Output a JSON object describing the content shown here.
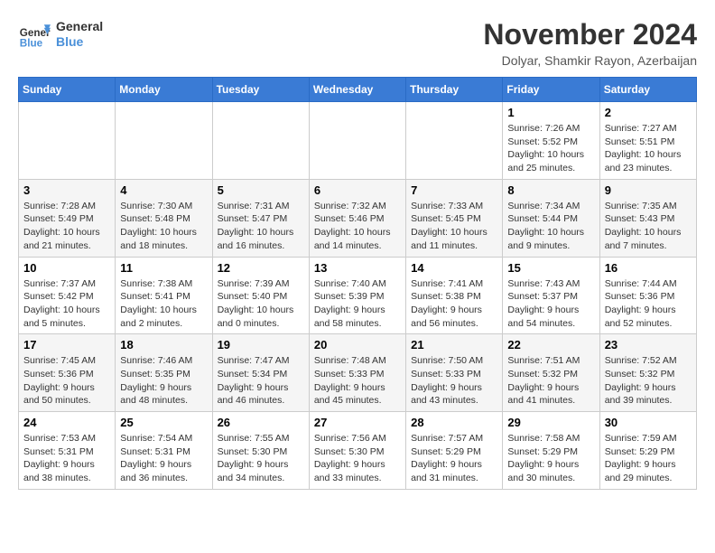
{
  "header": {
    "logo_line1": "General",
    "logo_line2": "Blue",
    "month_title": "November 2024",
    "subtitle": "Dolyar, Shamkir Rayon, Azerbaijan"
  },
  "weekdays": [
    "Sunday",
    "Monday",
    "Tuesday",
    "Wednesday",
    "Thursday",
    "Friday",
    "Saturday"
  ],
  "weeks": [
    [
      {
        "day": "",
        "info": ""
      },
      {
        "day": "",
        "info": ""
      },
      {
        "day": "",
        "info": ""
      },
      {
        "day": "",
        "info": ""
      },
      {
        "day": "",
        "info": ""
      },
      {
        "day": "1",
        "info": "Sunrise: 7:26 AM\nSunset: 5:52 PM\nDaylight: 10 hours and 25 minutes."
      },
      {
        "day": "2",
        "info": "Sunrise: 7:27 AM\nSunset: 5:51 PM\nDaylight: 10 hours and 23 minutes."
      }
    ],
    [
      {
        "day": "3",
        "info": "Sunrise: 7:28 AM\nSunset: 5:49 PM\nDaylight: 10 hours and 21 minutes."
      },
      {
        "day": "4",
        "info": "Sunrise: 7:30 AM\nSunset: 5:48 PM\nDaylight: 10 hours and 18 minutes."
      },
      {
        "day": "5",
        "info": "Sunrise: 7:31 AM\nSunset: 5:47 PM\nDaylight: 10 hours and 16 minutes."
      },
      {
        "day": "6",
        "info": "Sunrise: 7:32 AM\nSunset: 5:46 PM\nDaylight: 10 hours and 14 minutes."
      },
      {
        "day": "7",
        "info": "Sunrise: 7:33 AM\nSunset: 5:45 PM\nDaylight: 10 hours and 11 minutes."
      },
      {
        "day": "8",
        "info": "Sunrise: 7:34 AM\nSunset: 5:44 PM\nDaylight: 10 hours and 9 minutes."
      },
      {
        "day": "9",
        "info": "Sunrise: 7:35 AM\nSunset: 5:43 PM\nDaylight: 10 hours and 7 minutes."
      }
    ],
    [
      {
        "day": "10",
        "info": "Sunrise: 7:37 AM\nSunset: 5:42 PM\nDaylight: 10 hours and 5 minutes."
      },
      {
        "day": "11",
        "info": "Sunrise: 7:38 AM\nSunset: 5:41 PM\nDaylight: 10 hours and 2 minutes."
      },
      {
        "day": "12",
        "info": "Sunrise: 7:39 AM\nSunset: 5:40 PM\nDaylight: 10 hours and 0 minutes."
      },
      {
        "day": "13",
        "info": "Sunrise: 7:40 AM\nSunset: 5:39 PM\nDaylight: 9 hours and 58 minutes."
      },
      {
        "day": "14",
        "info": "Sunrise: 7:41 AM\nSunset: 5:38 PM\nDaylight: 9 hours and 56 minutes."
      },
      {
        "day": "15",
        "info": "Sunrise: 7:43 AM\nSunset: 5:37 PM\nDaylight: 9 hours and 54 minutes."
      },
      {
        "day": "16",
        "info": "Sunrise: 7:44 AM\nSunset: 5:36 PM\nDaylight: 9 hours and 52 minutes."
      }
    ],
    [
      {
        "day": "17",
        "info": "Sunrise: 7:45 AM\nSunset: 5:36 PM\nDaylight: 9 hours and 50 minutes."
      },
      {
        "day": "18",
        "info": "Sunrise: 7:46 AM\nSunset: 5:35 PM\nDaylight: 9 hours and 48 minutes."
      },
      {
        "day": "19",
        "info": "Sunrise: 7:47 AM\nSunset: 5:34 PM\nDaylight: 9 hours and 46 minutes."
      },
      {
        "day": "20",
        "info": "Sunrise: 7:48 AM\nSunset: 5:33 PM\nDaylight: 9 hours and 45 minutes."
      },
      {
        "day": "21",
        "info": "Sunrise: 7:50 AM\nSunset: 5:33 PM\nDaylight: 9 hours and 43 minutes."
      },
      {
        "day": "22",
        "info": "Sunrise: 7:51 AM\nSunset: 5:32 PM\nDaylight: 9 hours and 41 minutes."
      },
      {
        "day": "23",
        "info": "Sunrise: 7:52 AM\nSunset: 5:32 PM\nDaylight: 9 hours and 39 minutes."
      }
    ],
    [
      {
        "day": "24",
        "info": "Sunrise: 7:53 AM\nSunset: 5:31 PM\nDaylight: 9 hours and 38 minutes."
      },
      {
        "day": "25",
        "info": "Sunrise: 7:54 AM\nSunset: 5:31 PM\nDaylight: 9 hours and 36 minutes."
      },
      {
        "day": "26",
        "info": "Sunrise: 7:55 AM\nSunset: 5:30 PM\nDaylight: 9 hours and 34 minutes."
      },
      {
        "day": "27",
        "info": "Sunrise: 7:56 AM\nSunset: 5:30 PM\nDaylight: 9 hours and 33 minutes."
      },
      {
        "day": "28",
        "info": "Sunrise: 7:57 AM\nSunset: 5:29 PM\nDaylight: 9 hours and 31 minutes."
      },
      {
        "day": "29",
        "info": "Sunrise: 7:58 AM\nSunset: 5:29 PM\nDaylight: 9 hours and 30 minutes."
      },
      {
        "day": "30",
        "info": "Sunrise: 7:59 AM\nSunset: 5:29 PM\nDaylight: 9 hours and 29 minutes."
      }
    ]
  ]
}
